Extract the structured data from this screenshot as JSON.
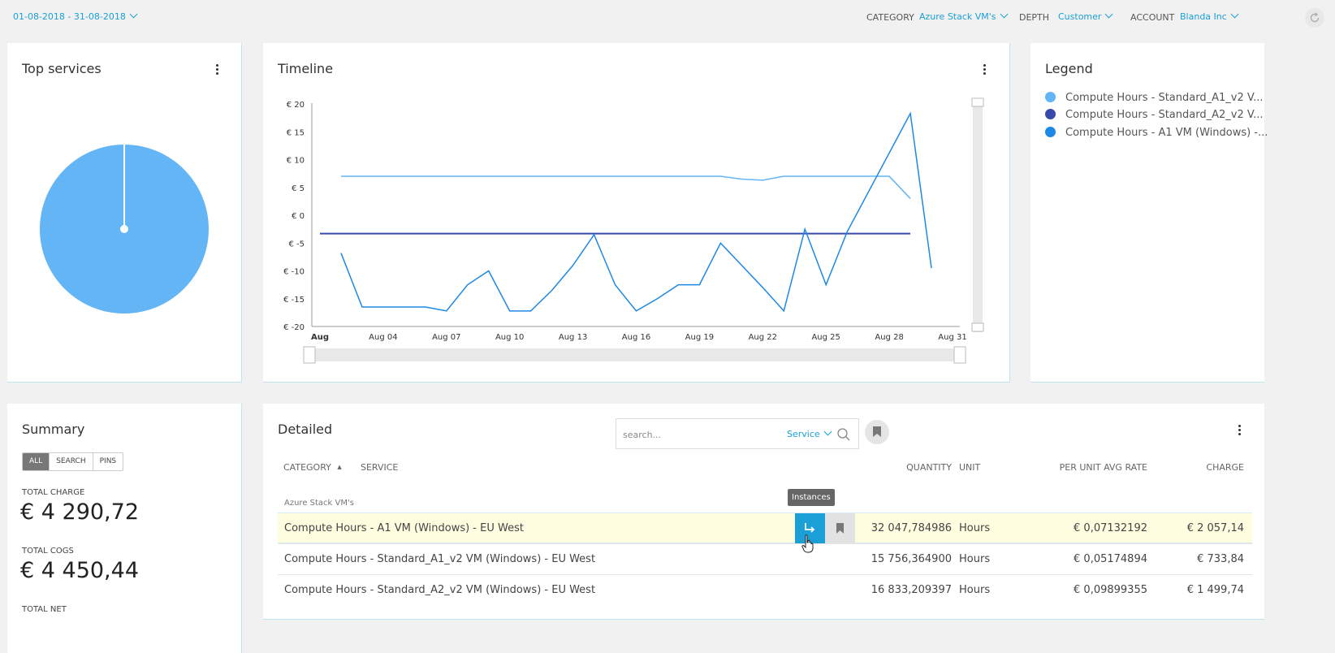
{
  "topbar": {
    "date_range": "01-08-2018 - 31-08-2018",
    "category_label": "CATEGORY",
    "category_value": "Azure Stack VM's",
    "depth_label": "DEPTH",
    "depth_value": "Customer",
    "account_label": "ACCOUNT",
    "account_value": "Blanda Inc"
  },
  "top_services": {
    "title": "Top services",
    "pie_color": "#64b5f6"
  },
  "timeline": {
    "title": "Timeline"
  },
  "legend": {
    "title": "Legend",
    "items": [
      {
        "label": "Compute Hours - Standard_A1_v2 V...",
        "color": "#64b5f6"
      },
      {
        "label": "Compute Hours - Standard_A2_v2 V...",
        "color": "#3949ab"
      },
      {
        "label": "Compute Hours - A1 VM (Windows) -...",
        "color": "#1e88e5"
      }
    ]
  },
  "summary": {
    "title": "Summary",
    "filters": [
      "ALL",
      "SEARCH",
      "PINS"
    ],
    "active_filter": "ALL",
    "total_charge_label": "TOTAL CHARGE",
    "total_charge": "€ 4 290,72",
    "total_cogs_label": "TOTAL COGS",
    "total_cogs": "€ 4 450,44",
    "total_net_label": "TOTAL NET"
  },
  "detailed": {
    "title": "Detailed",
    "search_placeholder": "search...",
    "search_mode": "Service",
    "columns": {
      "category": "CATEGORY",
      "service": "SERVICE",
      "quantity": "QUANTITY",
      "unit": "UNIT",
      "rate": "PER UNIT AVG RATE",
      "charge": "CHARGE"
    },
    "group": "Azure Stack VM's",
    "tooltip": "Instances",
    "rows": [
      {
        "service": "Compute Hours - A1 VM (Windows) - EU West",
        "quantity": "32 047,784986",
        "unit": "Hours",
        "rate": "€ 0,07132192",
        "charge": "€ 2 057,14"
      },
      {
        "service": "Compute Hours - Standard_A1_v2 VM (Windows) - EU West",
        "quantity": "15 756,364900",
        "unit": "Hours",
        "rate": "€ 0,05174894",
        "charge": "€ 733,84"
      },
      {
        "service": "Compute Hours - Standard_A2_v2 VM (Windows) - EU West",
        "quantity": "16 833,209397",
        "unit": "Hours",
        "rate": "€ 0,09899355",
        "charge": "€ 1 499,74"
      }
    ]
  },
  "chart_data": {
    "type": "line",
    "ylim": [
      -20,
      20
    ],
    "y_ticks": [
      "€ 20",
      "€ 15",
      "€ 10",
      "€ 5",
      "€ 0",
      "€ -5",
      "€ -10",
      "€ -15",
      "€ -20"
    ],
    "x_ticks": [
      "Aug",
      "Aug 04",
      "Aug 07",
      "Aug 10",
      "Aug 13",
      "Aug 16",
      "Aug 19",
      "Aug 22",
      "Aug 25",
      "Aug 28",
      "Aug 31"
    ],
    "series": [
      {
        "name": "Compute Hours - Standard_A1_v2 V...",
        "color": "#64b5f6",
        "points": [
          [
            2,
            7
          ],
          [
            3,
            7
          ],
          [
            4,
            7
          ],
          [
            5,
            7
          ],
          [
            6,
            7
          ],
          [
            7,
            7
          ],
          [
            8,
            7
          ],
          [
            9,
            7
          ],
          [
            10,
            7
          ],
          [
            11,
            7
          ],
          [
            12,
            7
          ],
          [
            13,
            7
          ],
          [
            14,
            7
          ],
          [
            15,
            7
          ],
          [
            16,
            7
          ],
          [
            17,
            7
          ],
          [
            18,
            7
          ],
          [
            19,
            7
          ],
          [
            20,
            7
          ],
          [
            21,
            6.5
          ],
          [
            22,
            6.3
          ],
          [
            23,
            7
          ],
          [
            24,
            7
          ],
          [
            25,
            7
          ],
          [
            26,
            7
          ],
          [
            27,
            7
          ],
          [
            28,
            7
          ],
          [
            29,
            3
          ]
        ]
      },
      {
        "name": "Compute Hours - Standard_A2_v2 V...",
        "color": "#3949ab",
        "points": [
          [
            1,
            -3.3
          ],
          [
            29,
            -3.3
          ]
        ]
      },
      {
        "name": "Compute Hours - A1 VM (Windows) -...",
        "color": "#1e88e5",
        "points": [
          [
            2,
            -6.8
          ],
          [
            3,
            -16.5
          ],
          [
            4,
            -16.5
          ],
          [
            5,
            -16.5
          ],
          [
            6,
            -16.5
          ],
          [
            7,
            -17.2
          ],
          [
            8,
            -12.5
          ],
          [
            9,
            -10
          ],
          [
            10,
            -17.2
          ],
          [
            11,
            -17.2
          ],
          [
            12,
            -13.5
          ],
          [
            13,
            -9
          ],
          [
            14,
            -3.5
          ],
          [
            15,
            -12.5
          ],
          [
            16,
            -17.2
          ],
          [
            17,
            -15
          ],
          [
            18,
            -12.5
          ],
          [
            19,
            -12.5
          ],
          [
            20,
            -5
          ],
          [
            21,
            -9
          ],
          [
            22,
            -13
          ],
          [
            23,
            -17.2
          ],
          [
            24,
            -2.5
          ],
          [
            25,
            -12.5
          ],
          [
            26,
            -3
          ],
          [
            29,
            18.3
          ],
          [
            30,
            -9.5
          ]
        ]
      }
    ]
  }
}
